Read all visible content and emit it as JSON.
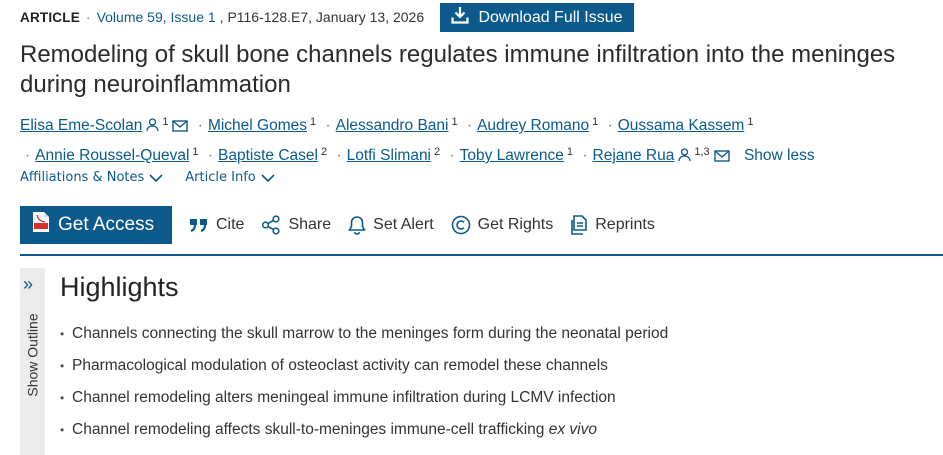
{
  "meta": {
    "article_type": "ARTICLE",
    "separator": "·",
    "volume": "Volume 59, Issue 1",
    "pages_date": "P116-128.E7, January 13, 2026",
    "download_label": "Download Full Issue"
  },
  "title": "Remodeling of skull bone channels regulates immune infiltration into the meninges during neuroinflammation",
  "authors": [
    {
      "name": "Elisa Eme-Scolan",
      "aff": "1",
      "person_icon": true,
      "mail_icon": true
    },
    {
      "name": "Michel Gomes",
      "aff": "1"
    },
    {
      "name": "Alessandro Bani",
      "aff": "1"
    },
    {
      "name": "Audrey Romano",
      "aff": "1"
    },
    {
      "name": "Oussama Kassem",
      "aff": "1"
    },
    {
      "name": "Annie Roussel-Queval",
      "aff": "1"
    },
    {
      "name": "Baptiste Casel",
      "aff": "2"
    },
    {
      "name": "Lotfi Slimani",
      "aff": "2"
    },
    {
      "name": "Toby Lawrence",
      "aff": "1"
    },
    {
      "name": "Rejane Rua",
      "aff": "1,3",
      "person_icon": true,
      "mail_icon": true
    }
  ],
  "show_less_label": "Show less",
  "affiliations_label": "Affiliations & Notes",
  "article_info_label": "Article Info",
  "toolbar": {
    "get_access": "Get Access",
    "cite": "Cite",
    "share": "Share",
    "set_alert": "Set Alert",
    "get_rights": "Get Rights",
    "reprints": "Reprints"
  },
  "outline": {
    "label": "Show Outline",
    "chevron": "»"
  },
  "highlights": {
    "heading": "Highlights",
    "items": [
      {
        "text": "Channels connecting the skull marrow to the meninges form during the neonatal period",
        "em": ""
      },
      {
        "text": "Pharmacological modulation of osteoclast activity can remodel these channels",
        "em": ""
      },
      {
        "text": "Channel remodeling alters meningeal immune infiltration during LCMV infection",
        "em": ""
      },
      {
        "text": "Channel remodeling affects skull-to-meninges immune-cell trafficking ",
        "em": "ex vivo"
      }
    ]
  },
  "colors": {
    "brand": "#0c5a8c",
    "outline_bg": "#ececec"
  },
  "icons": {
    "download": "download-icon",
    "person": "person-icon",
    "mail": "mail-icon",
    "chevron": "chevron-down-icon",
    "pdf": "pdf-icon",
    "cite": "quote-icon",
    "share": "share-icon",
    "alert": "bell-icon",
    "rights": "copyright-icon",
    "reprints": "reprints-icon"
  }
}
